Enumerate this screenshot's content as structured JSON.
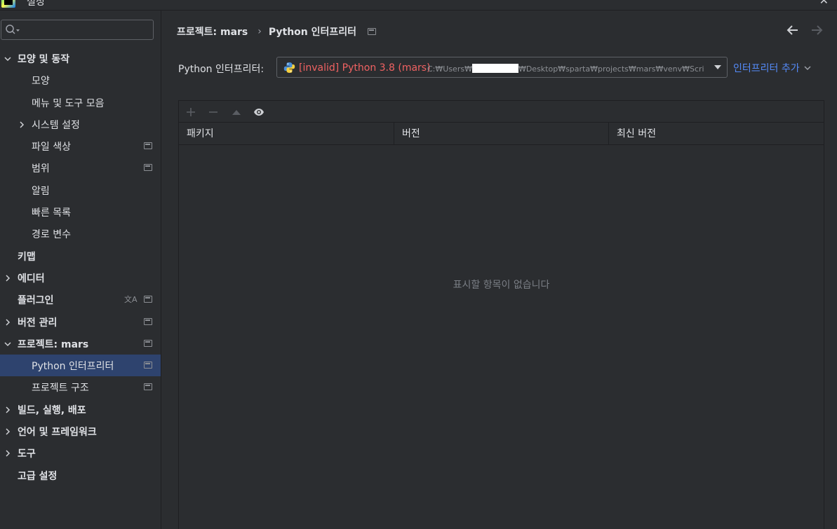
{
  "window": {
    "title": "설정"
  },
  "search": {
    "placeholder": "",
    "value": ""
  },
  "sidebar": {
    "items": [
      {
        "label": "모양 및 동작",
        "level": 0,
        "expand": "expanded",
        "bold": true,
        "mod": false
      },
      {
        "label": "모양",
        "level": 1,
        "expand": "none",
        "bold": false,
        "mod": false
      },
      {
        "label": "메뉴 및 도구 모음",
        "level": 1,
        "expand": "none",
        "bold": false,
        "mod": false
      },
      {
        "label": "시스템 설정",
        "level": 1,
        "expand": "collapsed",
        "bold": false,
        "mod": false
      },
      {
        "label": "파일 색상",
        "level": 1,
        "expand": "none",
        "bold": false,
        "mod": true
      },
      {
        "label": "범위",
        "level": 1,
        "expand": "none",
        "bold": false,
        "mod": true
      },
      {
        "label": "알림",
        "level": 1,
        "expand": "none",
        "bold": false,
        "mod": false
      },
      {
        "label": "빠른 목록",
        "level": 1,
        "expand": "none",
        "bold": false,
        "mod": false
      },
      {
        "label": "경로 변수",
        "level": 1,
        "expand": "none",
        "bold": false,
        "mod": false
      },
      {
        "label": "키맵",
        "level": 0,
        "expand": "none",
        "bold": true,
        "mod": false
      },
      {
        "label": "에디터",
        "level": 0,
        "expand": "collapsed",
        "bold": true,
        "mod": false
      },
      {
        "label": "플러그인",
        "level": 0,
        "expand": "none",
        "bold": true,
        "mod": true,
        "translate": true
      },
      {
        "label": "버전 관리",
        "level": 0,
        "expand": "collapsed",
        "bold": true,
        "mod": true
      },
      {
        "label": "프로젝트: mars",
        "level": 0,
        "expand": "expanded",
        "bold": true,
        "mod": true
      },
      {
        "label": "Python 인터프리터",
        "level": 1,
        "expand": "none",
        "bold": false,
        "mod": true,
        "selected": true
      },
      {
        "label": "프로젝트 구조",
        "level": 1,
        "expand": "none",
        "bold": false,
        "mod": true
      },
      {
        "label": "빌드, 실행, 배포",
        "level": 0,
        "expand": "collapsed",
        "bold": true,
        "mod": false
      },
      {
        "label": "언어 및 프레임워크",
        "level": 0,
        "expand": "collapsed",
        "bold": true,
        "mod": false
      },
      {
        "label": "도구",
        "level": 0,
        "expand": "collapsed",
        "bold": true,
        "mod": false
      },
      {
        "label": "고급 설정",
        "level": 0,
        "expand": "none",
        "bold": true,
        "mod": false
      }
    ]
  },
  "main": {
    "breadcrumb": {
      "parent": "프로젝트: mars",
      "separator": "›",
      "current": "Python 인터프리터"
    },
    "interpreter": {
      "label": "Python 인터프리터:",
      "name": "[invalid]  Python 3.8 (mars)",
      "path_prefix": "C:₩Users₩",
      "path_suffix": "₩Desktop₩sparta₩projects₩mars₩venv₩Scri",
      "add_label": "인터프리터 추가"
    },
    "packages": {
      "columns": [
        "패키지",
        "버전",
        "최신 버전"
      ],
      "empty_text": "표시할 항목이 없습니다"
    }
  },
  "colors": {
    "background": "#2b2d30",
    "selection": "#2e436e",
    "invalid": "#f06262",
    "link": "#548af7"
  }
}
